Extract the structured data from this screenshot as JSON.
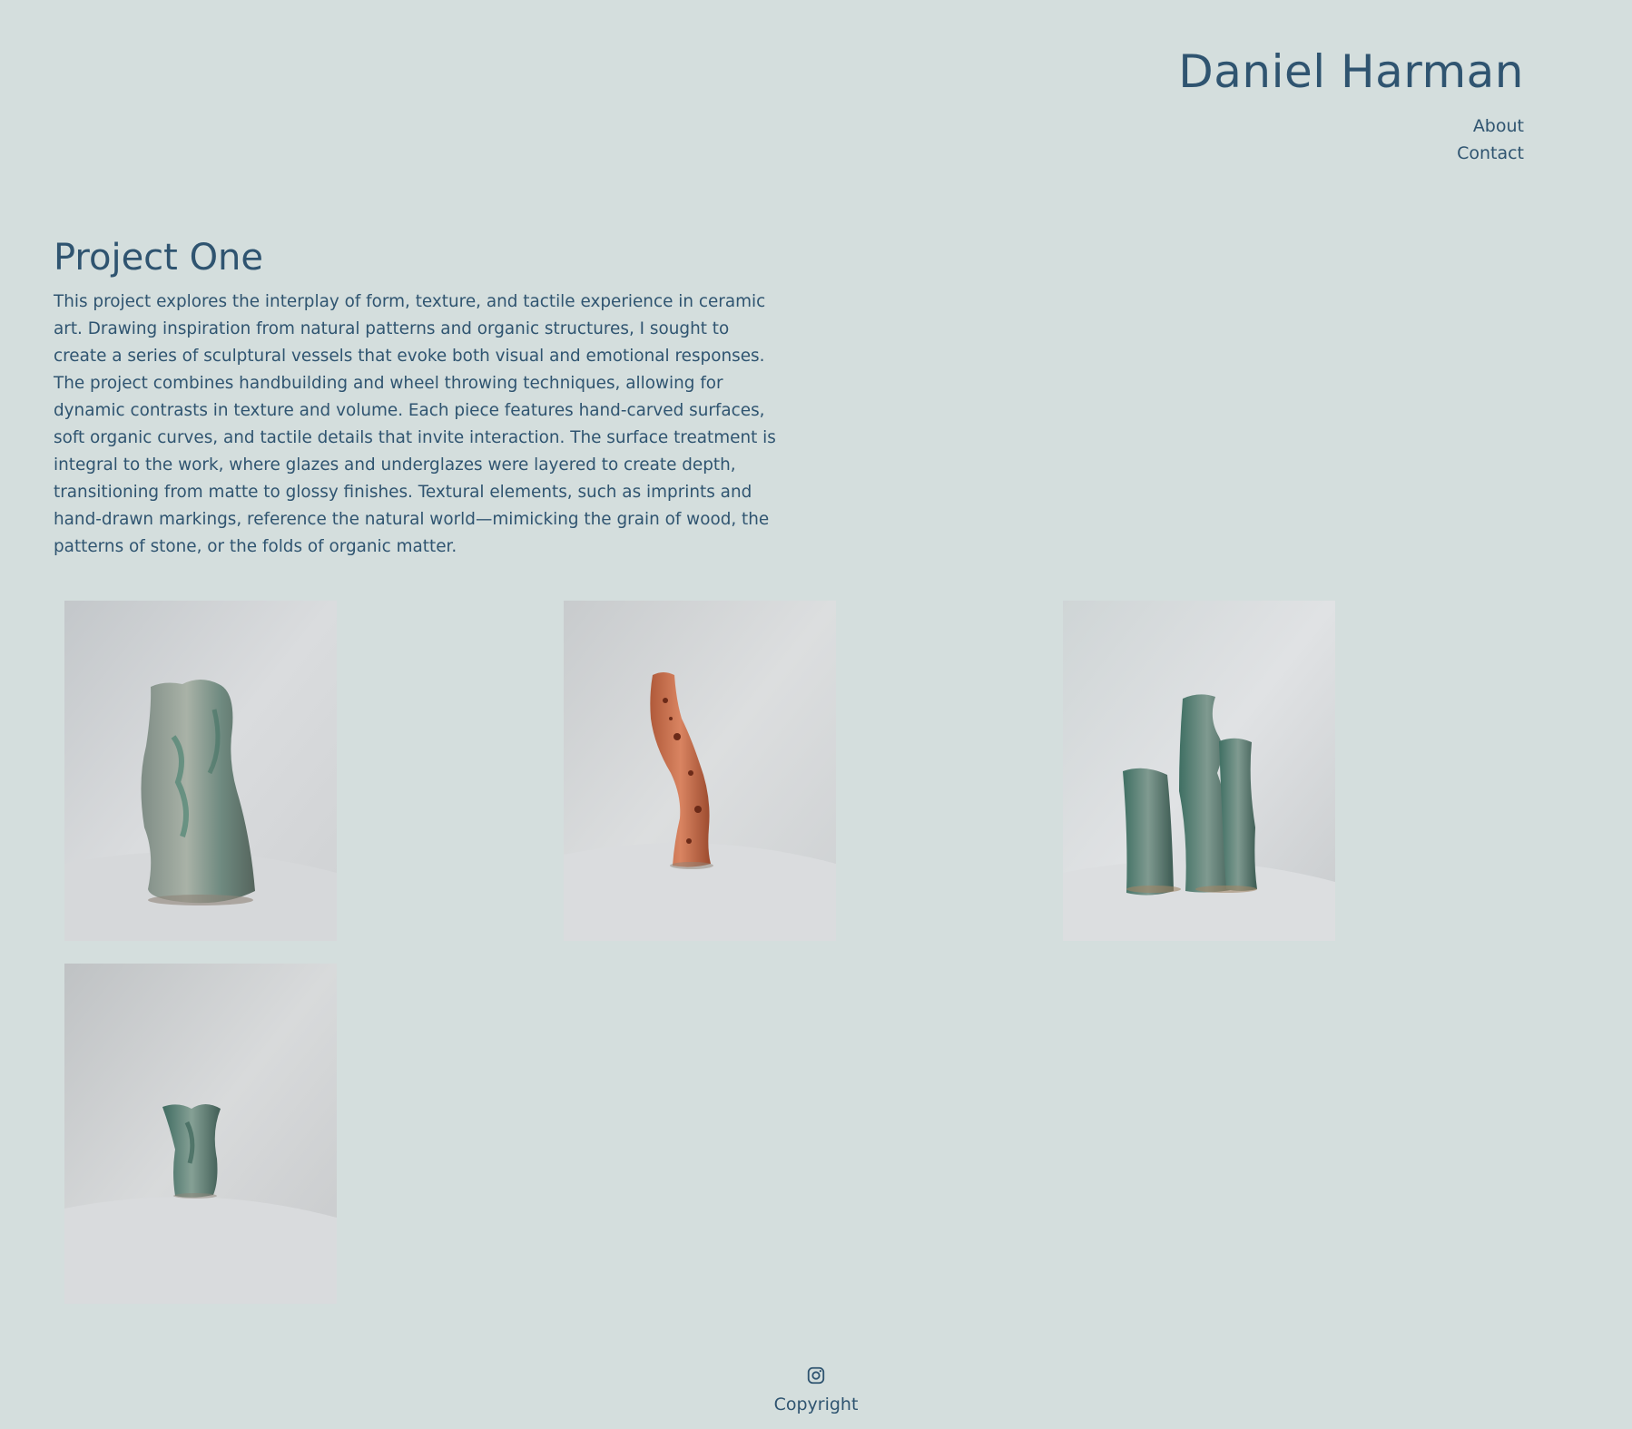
{
  "header": {
    "site_title": "Daniel Harman",
    "nav": [
      {
        "label": "About"
      },
      {
        "label": "Contact"
      }
    ]
  },
  "project": {
    "title": "Project One",
    "description": "This project explores the interplay of form, texture, and tactile experience in ceramic art. Drawing inspiration from natural patterns and organic structures, I sought to create a series of sculptural vessels that evoke both visual and emotional responses. The project combines handbuilding and wheel throwing techniques, allowing for dynamic contrasts in texture and volume. Each piece features hand-carved surfaces, soft organic curves, and tactile details that invite interaction. The surface treatment is integral to the work, where glazes and underglazes were layered to create depth, transitioning from matte to glossy finishes. Textural elements, such as imprints and hand-drawn markings, reference the natural world—mimicking the grain of wood, the patterns of stone, or the folds of organic matter."
  },
  "gallery": {
    "images": [
      {
        "subject": "green-grey glazed ceramic vase"
      },
      {
        "subject": "orange speckled twisted ceramic vase"
      },
      {
        "subject": "group of green glazed ceramic vessels"
      },
      {
        "subject": "small green glazed ceramic vase"
      }
    ]
  },
  "footer": {
    "icon": "instagram-icon",
    "copyright": "Copyright"
  },
  "colors": {
    "background": "#d4dedd",
    "text": "#2f5470"
  }
}
